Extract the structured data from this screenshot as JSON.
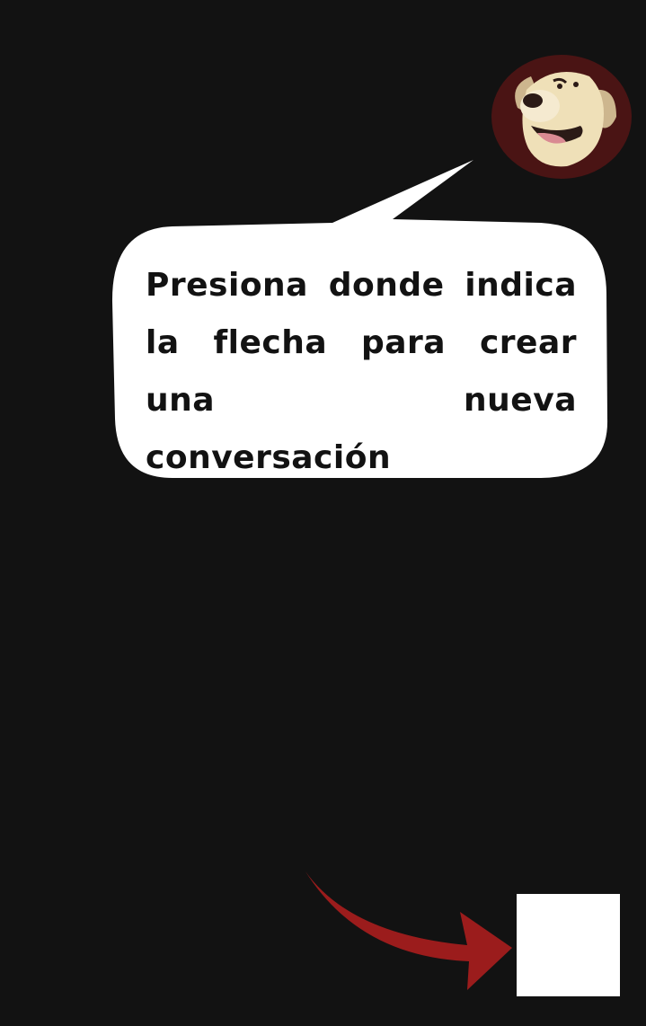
{
  "tutorial": {
    "message": "Presiona donde indica la flecha para crear una nueva conversación"
  },
  "icons": {
    "avatar": "dog-mascot-icon",
    "pointer": "curved-arrow-icon"
  },
  "colors": {
    "background": "#121212",
    "bubble": "#ffffff",
    "arrow": "#9b1c1c",
    "avatar_ring": "#4a1414"
  }
}
